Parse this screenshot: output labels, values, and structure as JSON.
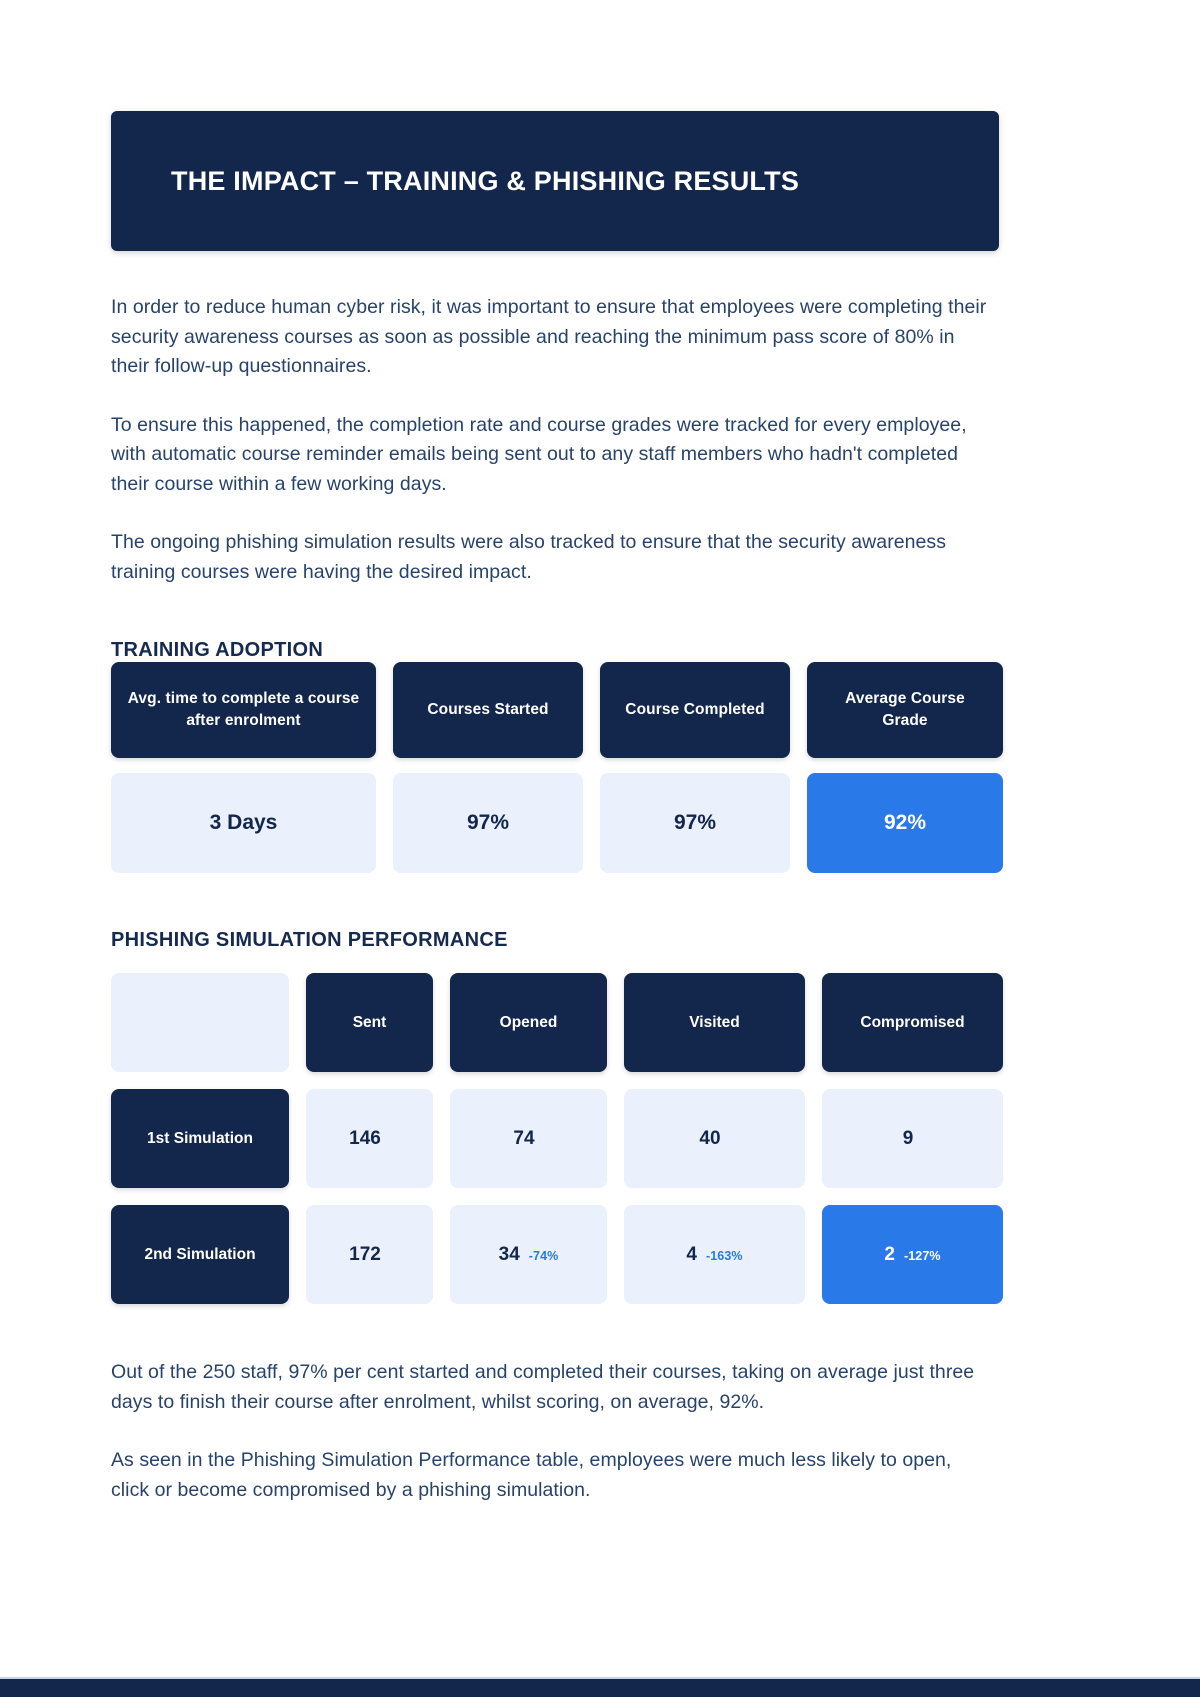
{
  "header": {
    "title": "THE IMPACT – TRAINING & PHISHING RESULTS"
  },
  "intro": {
    "paragraph_1": "In order to reduce human cyber risk, it was important to ensure that employees were completing their security awareness courses as soon as possible and reaching the minimum pass score of 80% in their follow-up questionnaires.",
    "paragraph_2": "To ensure this happened, the completion rate and course grades were tracked for every employee, with automatic course reminder emails being sent out to any staff members who hadn't completed their course within a few working days.",
    "paragraph_3": "The ongoing phishing simulation results were also tracked to ensure that the security awareness training courses were having the desired impact."
  },
  "training_adoption": {
    "heading": "TRAINING ADOPTION",
    "metrics": [
      {
        "label": "Avg. time to complete a course after enrolment",
        "value": "3 Days",
        "highlight": false
      },
      {
        "label": "Courses Started",
        "value": "97%",
        "highlight": false
      },
      {
        "label": "Course Completed",
        "value": "97%",
        "highlight": false
      },
      {
        "label": "Average Course Grade",
        "value": "92%",
        "highlight": true
      }
    ]
  },
  "phishing_performance": {
    "heading": "PHISHING SIMULATION PERFORMANCE",
    "corner_label": "",
    "columns": [
      "Sent",
      "Opened",
      "Visited",
      "Compromised"
    ],
    "rows": [
      {
        "label": "1st Simulation",
        "cells": [
          {
            "value": "146",
            "delta": "",
            "highlight": false
          },
          {
            "value": "74",
            "delta": "",
            "highlight": false
          },
          {
            "value": "40",
            "delta": "",
            "highlight": false
          },
          {
            "value": "9",
            "delta": "",
            "highlight": false
          }
        ]
      },
      {
        "label": "2nd Simulation",
        "cells": [
          {
            "value": "172",
            "delta": "",
            "highlight": false
          },
          {
            "value": "34",
            "delta": "-74%",
            "highlight": false
          },
          {
            "value": "4",
            "delta": "-163%",
            "highlight": false
          },
          {
            "value": "2",
            "delta": "-127%",
            "highlight": true
          }
        ]
      }
    ]
  },
  "summary": {
    "paragraph_1": "Out of the 250 staff, 97% per cent started and completed their courses, taking on average just three days to finish their course after enrolment, whilst scoring, on average, 92%.",
    "paragraph_2": "As seen in the Phishing Simulation Performance table, employees were much less likely to open, click or become compromised by a phishing simulation."
  },
  "colors": {
    "navy": "#13264c",
    "accent_blue": "#2979e8",
    "pale_blue": "#eaf1fd",
    "body_text": "#28436b"
  }
}
